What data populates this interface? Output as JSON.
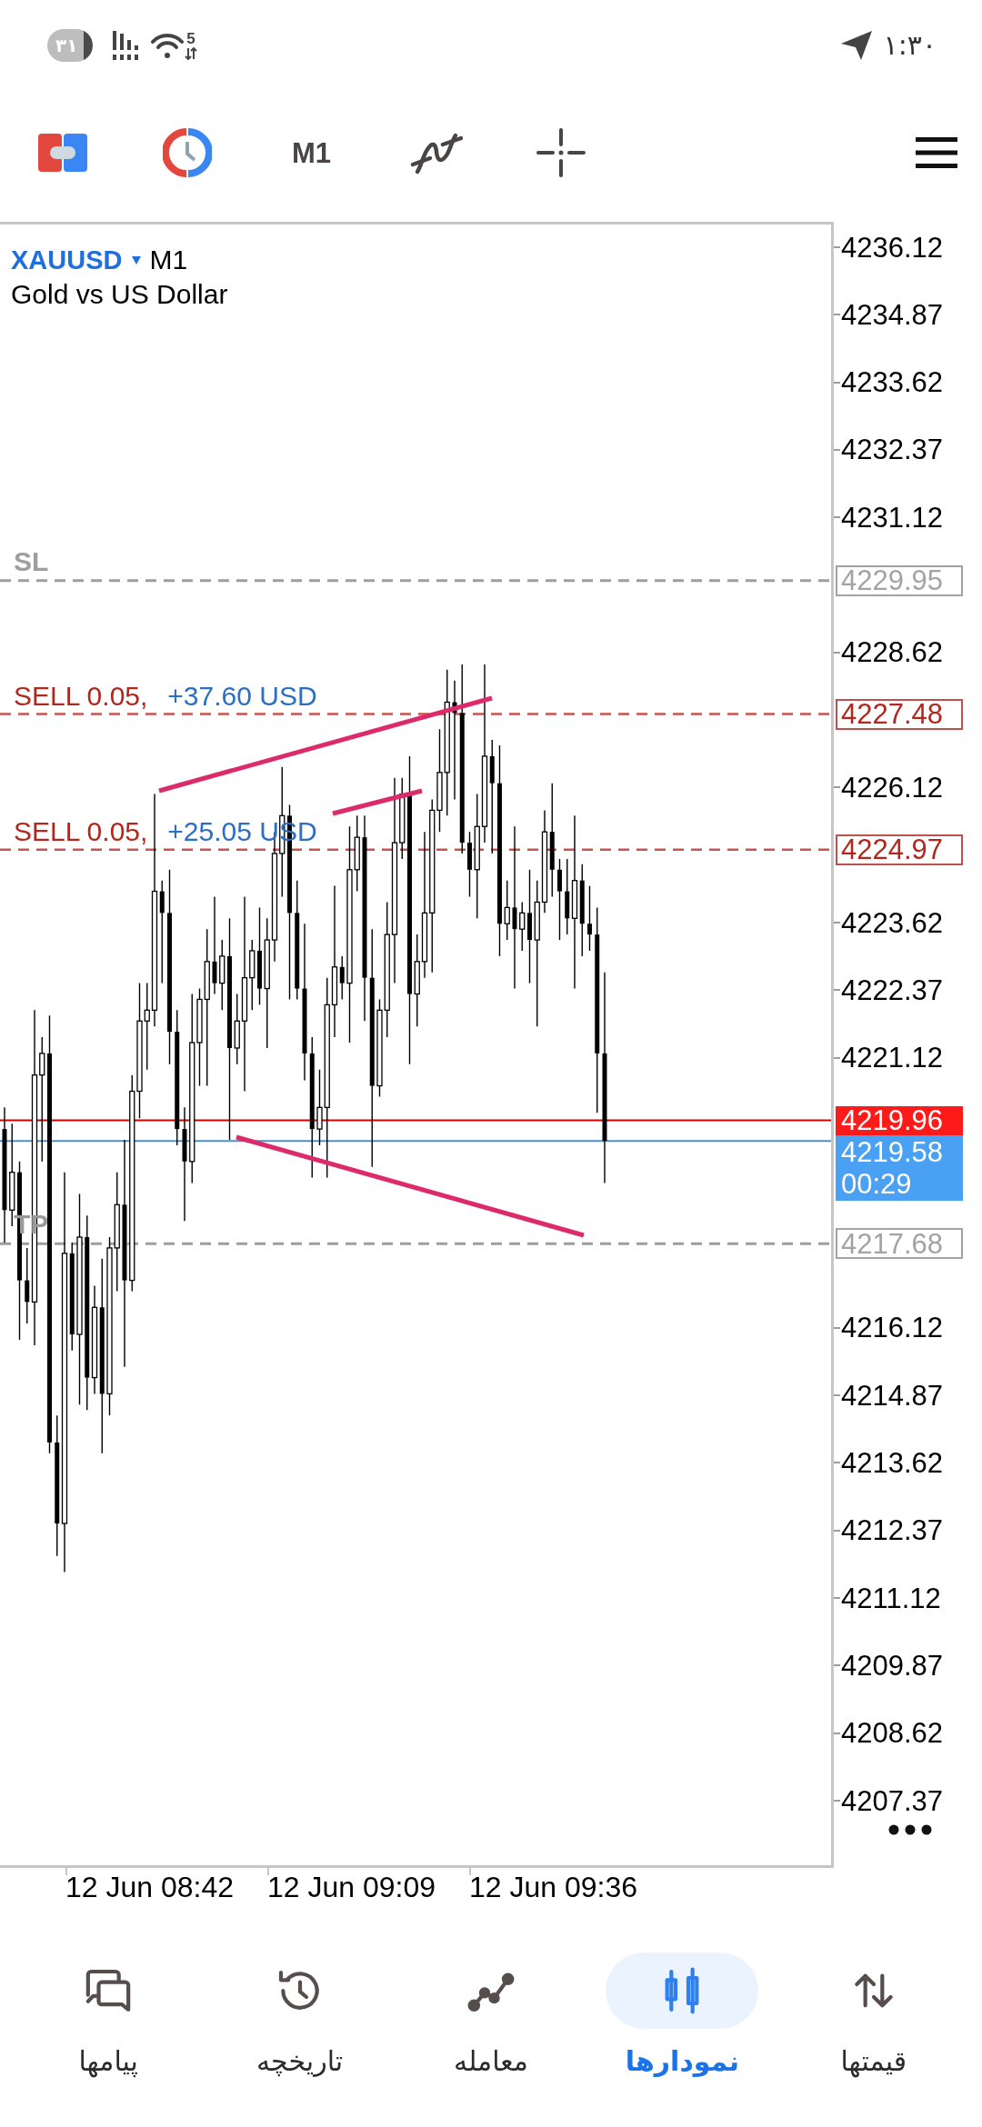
{
  "status_bar": {
    "battery": "٣١",
    "wifi_badge": "5",
    "time": "١:٣٠"
  },
  "toolbar": {
    "timeframe": "M1"
  },
  "chart": {
    "symbol": "XAUUSD",
    "timeframe": "M1",
    "description": "Gold vs US Dollar",
    "levels": [
      {
        "kind": "sl",
        "label": "SL",
        "price": "4229.95"
      },
      {
        "kind": "order",
        "label": "SELL 0.05,",
        "profit": "+37.60 USD",
        "price": "4227.48"
      },
      {
        "kind": "order",
        "label": "SELL 0.05,",
        "profit": "+25.05 USD",
        "price": "4224.97"
      },
      {
        "kind": "ask",
        "price": "4219.96"
      },
      {
        "kind": "bid",
        "price": "4219.58",
        "timer": "00:29"
      },
      {
        "kind": "tp",
        "label": "TP",
        "price": "4217.68"
      }
    ],
    "price_axis": [
      "4236.12",
      "4234.87",
      "4233.62",
      "4232.37",
      "4231.12",
      "4228.62",
      "4226.12",
      "4223.62",
      "4222.37",
      "4221.12",
      "4216.12",
      "4214.87",
      "4213.62",
      "4212.37",
      "4211.12",
      "4209.87",
      "4208.62",
      "4207.37"
    ],
    "time_axis": [
      "12 Jun 08:42",
      "12 Jun 09:09",
      "12 Jun 09:36"
    ]
  },
  "nav": [
    {
      "kind": "quotes",
      "label": "قیمتها",
      "selected": false
    },
    {
      "kind": "charts",
      "label": "نمودارها",
      "selected": true
    },
    {
      "kind": "trade",
      "label": "معامله",
      "selected": false
    },
    {
      "kind": "history",
      "label": "تاریخچه",
      "selected": false
    },
    {
      "kind": "messages",
      "label": "پیامها",
      "selected": false
    }
  ]
}
